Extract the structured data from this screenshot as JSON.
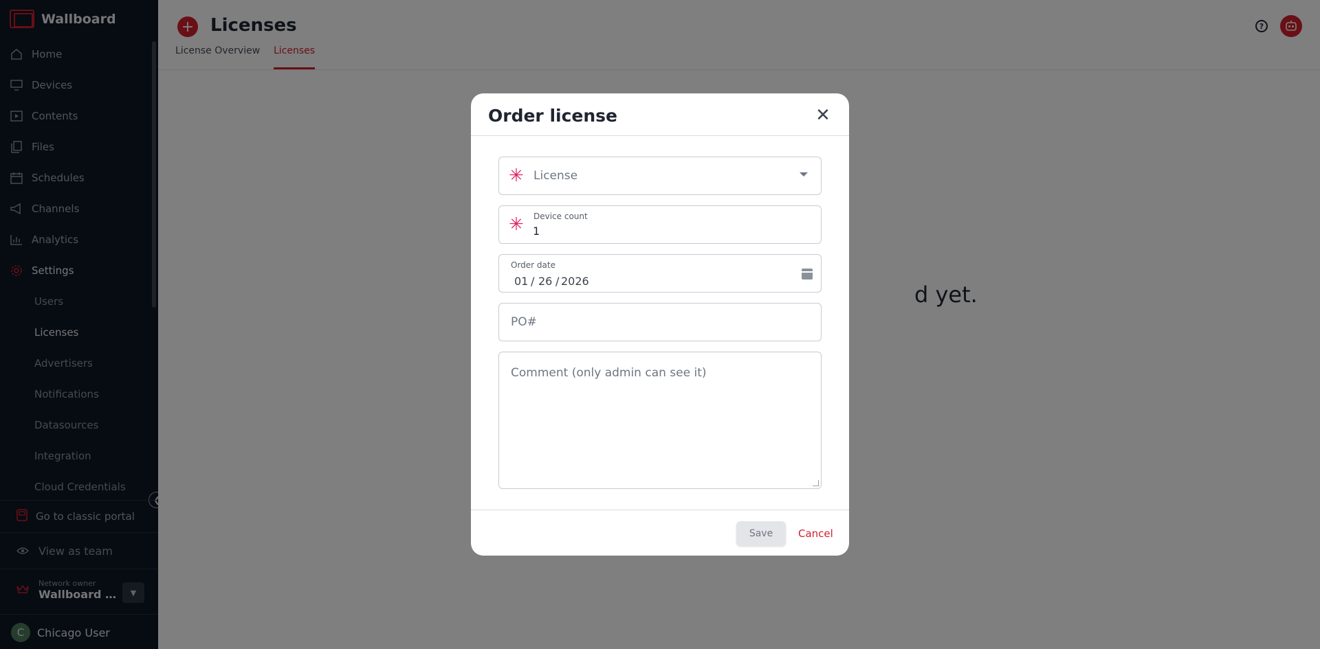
{
  "app": {
    "brand": "Wallboard"
  },
  "sidebar": {
    "items": [
      {
        "label": "Home",
        "icon": "home-icon"
      },
      {
        "label": "Devices",
        "icon": "monitor-icon"
      },
      {
        "label": "Contents",
        "icon": "play-icon"
      },
      {
        "label": "Files",
        "icon": "files-icon"
      },
      {
        "label": "Schedules",
        "icon": "calendar-icon"
      },
      {
        "label": "Channels",
        "icon": "megaphone-icon"
      },
      {
        "label": "Analytics",
        "icon": "chart-icon"
      },
      {
        "label": "Settings",
        "icon": "gear-icon"
      }
    ],
    "settings_sub": [
      "Users",
      "Licenses",
      "Advertisers",
      "Notifications",
      "Datasources",
      "Integration",
      "Cloud Credentials"
    ],
    "classic_portal": "Go to classic portal",
    "view_as_team": "View as team",
    "network_owner_label": "Network owner",
    "network_owner_value": "Wallboard De...",
    "user_initial": "C",
    "user_name": "Chicago User"
  },
  "header": {
    "title": "Licenses",
    "tabs": [
      "License Overview",
      "Licenses"
    ],
    "active_tab": "Licenses"
  },
  "background_text": "d yet.",
  "modal": {
    "title": "Order license",
    "license_placeholder": "License",
    "device_count_label": "Device count",
    "device_count_value": "1",
    "order_date_label": "Order date",
    "order_date": {
      "month": "01",
      "day": "26",
      "year": "2026",
      "sep": "/"
    },
    "po_placeholder": "PO#",
    "comment_placeholder": "Comment (only admin can see it)",
    "save_label": "Save",
    "cancel_label": "Cancel"
  },
  "colors": {
    "accent": "#d0202c",
    "sidebar_bg": "#0f1724",
    "required": "#e0245e"
  }
}
